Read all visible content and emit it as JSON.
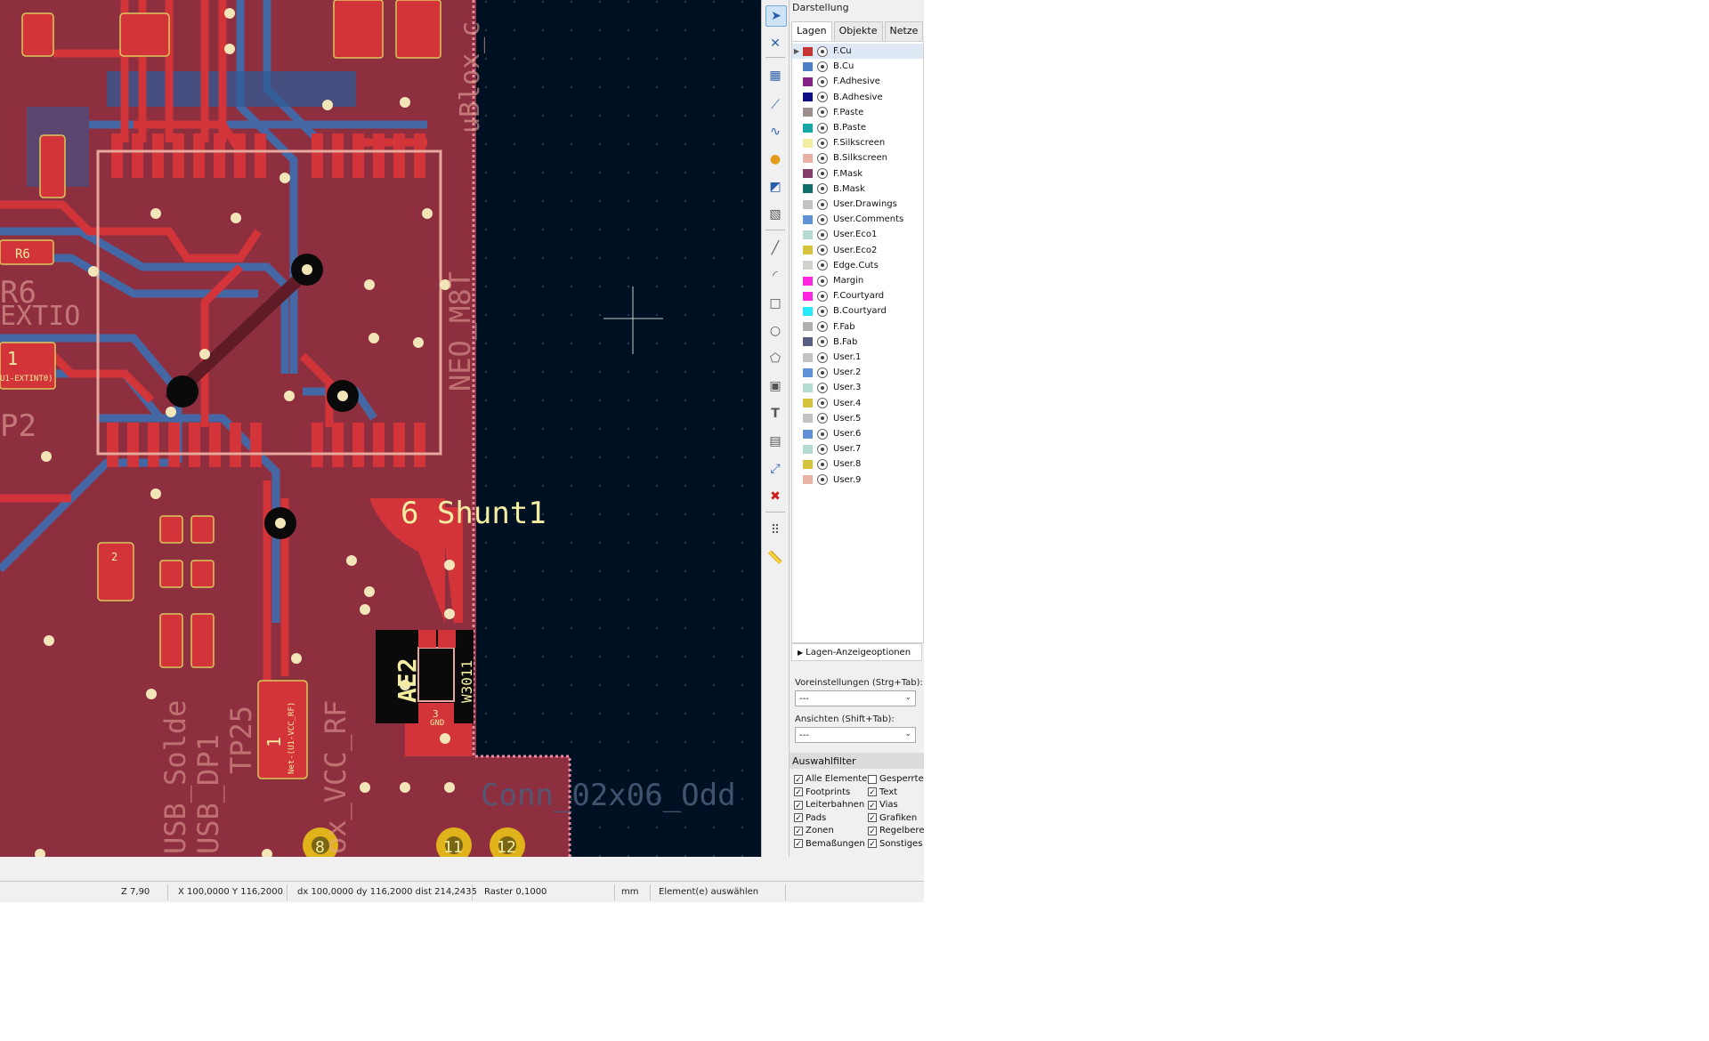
{
  "panel": {
    "title": "Darstellung",
    "tabs": [
      "Lagen",
      "Objekte",
      "Netze"
    ],
    "layers": [
      {
        "name": "F.Cu",
        "color": "#c83434",
        "selected": true
      },
      {
        "name": "B.Cu",
        "color": "#4d7fc4"
      },
      {
        "name": "F.Adhesive",
        "color": "#842184"
      },
      {
        "name": "B.Adhesive",
        "color": "#0f0f85"
      },
      {
        "name": "F.Paste",
        "color": "#9e8d8d"
      },
      {
        "name": "B.Paste",
        "color": "#15a6a6"
      },
      {
        "name": "F.Silkscreen",
        "color": "#f2eda1"
      },
      {
        "name": "B.Silkscreen",
        "color": "#e8b2a7"
      },
      {
        "name": "F.Mask",
        "color": "#833e6e"
      },
      {
        "name": "B.Mask",
        "color": "#0f6f6a"
      },
      {
        "name": "User.Drawings",
        "color": "#c2c2c2"
      },
      {
        "name": "User.Comments",
        "color": "#5f91d6"
      },
      {
        "name": "User.Eco1",
        "color": "#b4dbd2"
      },
      {
        "name": "User.Eco2",
        "color": "#d6c43d"
      },
      {
        "name": "Edge.Cuts",
        "color": "#d0d2cd"
      },
      {
        "name": "Margin",
        "color": "#ff26e2"
      },
      {
        "name": "F.Courtyard",
        "color": "#ff26e2"
      },
      {
        "name": "B.Courtyard",
        "color": "#26e9ff"
      },
      {
        "name": "F.Fab",
        "color": "#afafaf"
      },
      {
        "name": "B.Fab",
        "color": "#585d84"
      },
      {
        "name": "User.1",
        "color": "#c2c2c2"
      },
      {
        "name": "User.2",
        "color": "#5f91d6"
      },
      {
        "name": "User.3",
        "color": "#b4dbd2"
      },
      {
        "name": "User.4",
        "color": "#d6c43d"
      },
      {
        "name": "User.5",
        "color": "#c2c2c2"
      },
      {
        "name": "User.6",
        "color": "#5f91d6"
      },
      {
        "name": "User.7",
        "color": "#b4dbd2"
      },
      {
        "name": "User.8",
        "color": "#d6c43d"
      },
      {
        "name": "User.9",
        "color": "#e8b2a7"
      }
    ],
    "layer_options": "Lagen-Anzeigeoptionen",
    "presets_label": "Voreinstellungen (Strg+Tab):",
    "presets_value": "---",
    "views_label": "Ansichten (Shift+Tab):",
    "views_value": "---",
    "filter_title": "Auswahlfilter",
    "filters_left": [
      "Alle Elemente",
      "Footprints",
      "Leiterbahnen",
      "Pads",
      "Zonen",
      "Bemaßungen"
    ],
    "filters_right": [
      "Gesperrte E",
      "Text",
      "Vias",
      "Grafiken",
      "Regelbereic",
      "Sonstiges"
    ]
  },
  "status": {
    "zoom": "Z 7,90",
    "xy": "X 100,0000  Y 116,2000",
    "delta": "dx 100,0000  dy 116,2000  dist 214,2435",
    "grid": "Raster 0,1000",
    "units": "mm",
    "mode": "Element(e) auswählen"
  },
  "pcb": {
    "labels": {
      "ae2": "AE2",
      "w3011": "W3011",
      "shunt": "6 Shunt1",
      "conn": "Conn_02x06_Odd",
      "ublox": "uBlox_c",
      "neo": "NEO_M8T",
      "usb_solde": "USB_Solde",
      "usb_dp1": "USB_DP1",
      "tp25": "TP25",
      "vcc_rf": "ox_VCC_RF",
      "tp2": "P2",
      "r6": "R6",
      "exti": "EXTIO",
      "net_rf": "Net-(U1-VCC_RF)",
      "net_exti": "U1-EXTINT0)",
      "pad_one": "1",
      "pad_two": "2",
      "pad_three": "3",
      "gnd": "GND",
      "r6_box": "R6",
      "pin_11": "11",
      "pin_12": "12",
      "pin_8": "8"
    }
  }
}
